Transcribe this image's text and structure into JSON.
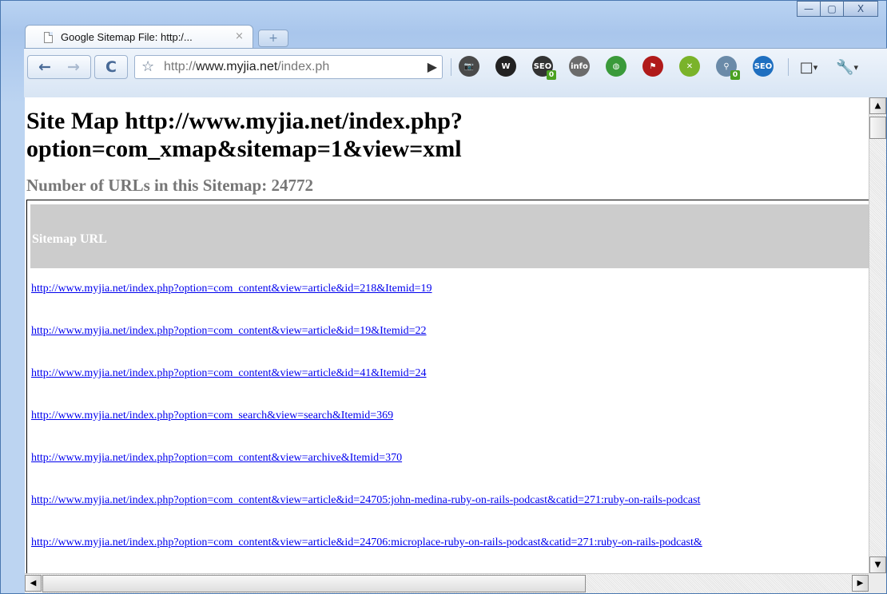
{
  "window": {
    "tab_title": "Google Sitemap File: http:/...",
    "tab_close": "×",
    "new_tab": "+",
    "minimize": "—",
    "maximize": "▢",
    "close": "X"
  },
  "toolbar": {
    "back": "←",
    "forward": "→",
    "reload": "C",
    "star": "☆",
    "url_prefix": "http://",
    "url_host": "www.myjia.net",
    "url_path": "/index.ph",
    "go": "▶",
    "extensions": [
      {
        "name": "camera-icon",
        "label": "📷",
        "color": "#4a4a4a"
      },
      {
        "name": "wikipedia-icon",
        "label": "W",
        "color": "#222222"
      },
      {
        "name": "seo-quake-icon",
        "label": "SEO",
        "color": "#333333",
        "badge": "0"
      },
      {
        "name": "info-icon",
        "label": "info",
        "color": "#6b6b6b"
      },
      {
        "name": "globe-icon",
        "label": "◍",
        "color": "#3a9a3a"
      },
      {
        "name": "flag-icon",
        "label": "⚑",
        "color": "#b01a1a"
      },
      {
        "name": "colorzilla-icon",
        "label": "✕",
        "color": "#7ab32a"
      },
      {
        "name": "magnifier-icon",
        "label": "⚲",
        "color": "#6a8aa8",
        "badge": "0"
      },
      {
        "name": "seo-site-tools-icon",
        "label": "SEO",
        "color": "#1e6fc0"
      }
    ],
    "page_menu": "▾",
    "wrench_menu": "▾"
  },
  "page": {
    "heading": "Site Map http://www.myjia.net/index.php?option=com_xmap&sitemap=1&view=xml",
    "count_text": "Number of URLs in this Sitemap: 24772",
    "table_header": "Sitemap URL",
    "urls": [
      "http://www.myjia.net/index.php?option=com_content&view=article&id=218&Itemid=19",
      "http://www.myjia.net/index.php?option=com_content&view=article&id=19&Itemid=22",
      "http://www.myjia.net/index.php?option=com_content&view=article&id=41&Itemid=24",
      "http://www.myjia.net/index.php?option=com_search&view=search&Itemid=369",
      "http://www.myjia.net/index.php?option=com_content&view=archive&Itemid=370",
      "http://www.myjia.net/index.php?option=com_content&view=article&id=24705:john-medina-ruby-on-rails-podcast&catid=271:ruby-on-rails-podcast",
      "http://www.myjia.net/index.php?option=com_content&view=article&id=24706:microplace-ruby-on-rails-podcast&catid=271:ruby-on-rails-podcast&"
    ]
  },
  "scrollbars": {
    "up": "▲",
    "down": "▼",
    "left": "◀",
    "right": "▶"
  }
}
